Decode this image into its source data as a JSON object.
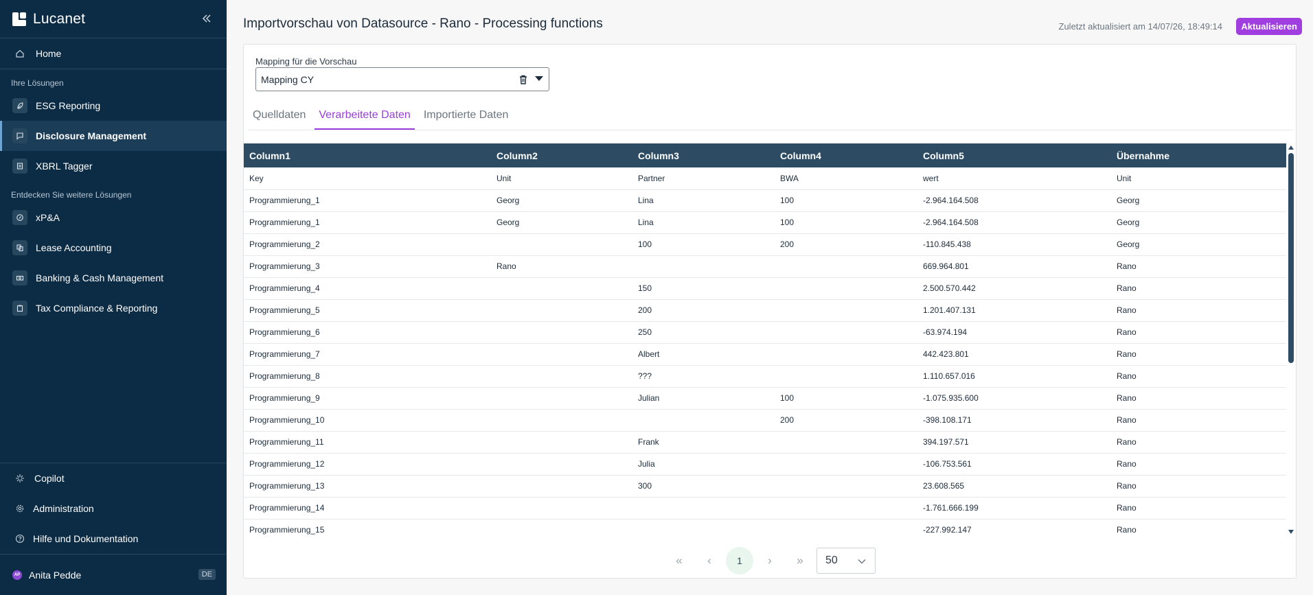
{
  "brand": {
    "name": "Lucanet"
  },
  "sidebar": {
    "home": "Home",
    "section_solutions": "Ihre Lösungen",
    "solutions": [
      {
        "label": "ESG Reporting"
      },
      {
        "label": "Disclosure Management"
      },
      {
        "label": "XBRL Tagger"
      }
    ],
    "section_discover": "Entdecken Sie weitere Lösungen",
    "discover": [
      {
        "label": "xP&A"
      },
      {
        "label": "Lease Accounting"
      },
      {
        "label": "Banking & Cash Management"
      },
      {
        "label": "Tax Compliance & Reporting"
      }
    ],
    "bottom": [
      {
        "label": "Copilot"
      },
      {
        "label": "Administration"
      },
      {
        "label": "Hilfe und Dokumentation"
      }
    ],
    "user": {
      "initials": "AP",
      "name": "Anita Pedde",
      "lang": "DE"
    }
  },
  "header": {
    "title": "Importvorschau von Datasource - Rano - Processing functions",
    "updated": "Zuletzt aktualisiert am 14/07/26, 18:49:14",
    "refresh_label": "Aktualisieren"
  },
  "mapping": {
    "label": "Mapping für die Vorschau",
    "value": "Mapping CY"
  },
  "tabs": [
    {
      "label": "Quelldaten"
    },
    {
      "label": "Verarbeitete Daten"
    },
    {
      "label": "Importierte Daten"
    }
  ],
  "table": {
    "columns": [
      "Column1",
      "Column2",
      "Column3",
      "Column4",
      "Column5",
      "Übernahme"
    ],
    "rows": [
      [
        "Key",
        "Unit",
        "Partner",
        "BWA",
        "wert",
        "Unit"
      ],
      [
        "Programmierung_1",
        "Georg",
        "Lina",
        "100",
        "-2.964.164.508",
        "Georg"
      ],
      [
        "Programmierung_1",
        "Georg",
        "Lina",
        "100",
        "-2.964.164.508",
        "Georg"
      ],
      [
        "Programmierung_2",
        "",
        "100",
        "200",
        "-110.845.438",
        "Georg"
      ],
      [
        "Programmierung_3",
        "Rano",
        "",
        "",
        "669.964.801",
        "Rano"
      ],
      [
        "Programmierung_4",
        "",
        "150",
        "",
        "2.500.570.442",
        "Rano"
      ],
      [
        "Programmierung_5",
        "",
        "200",
        "",
        "1.201.407.131",
        "Rano"
      ],
      [
        "Programmierung_6",
        "",
        "250",
        "",
        "-63.974.194",
        "Rano"
      ],
      [
        "Programmierung_7",
        "",
        "Albert",
        "",
        "442.423.801",
        "Rano"
      ],
      [
        "Programmierung_8",
        "",
        "???",
        "",
        "1.110.657.016",
        "Rano"
      ],
      [
        "Programmierung_9",
        "",
        "Julian",
        "100",
        "-1.075.935.600",
        "Rano"
      ],
      [
        "Programmierung_10",
        "",
        "",
        "200",
        "-398.108.171",
        "Rano"
      ],
      [
        "Programmierung_11",
        "",
        "Frank",
        "",
        "394.197.571",
        "Rano"
      ],
      [
        "Programmierung_12",
        "",
        "Julia",
        "",
        "-106.753.561",
        "Rano"
      ],
      [
        "Programmierung_13",
        "",
        "300",
        "",
        "23.608.565",
        "Rano"
      ],
      [
        "Programmierung_14",
        "",
        "",
        "",
        "-1.761.666.199",
        "Rano"
      ],
      [
        "Programmierung_15",
        "",
        "",
        "",
        "-227.992.147",
        "Rano"
      ]
    ]
  },
  "pagination": {
    "current_page": "1",
    "page_size": "50"
  },
  "colors": {
    "sidebar": "#0c2c45",
    "accent": "#a03ee0",
    "table_header": "#2d4b62"
  }
}
